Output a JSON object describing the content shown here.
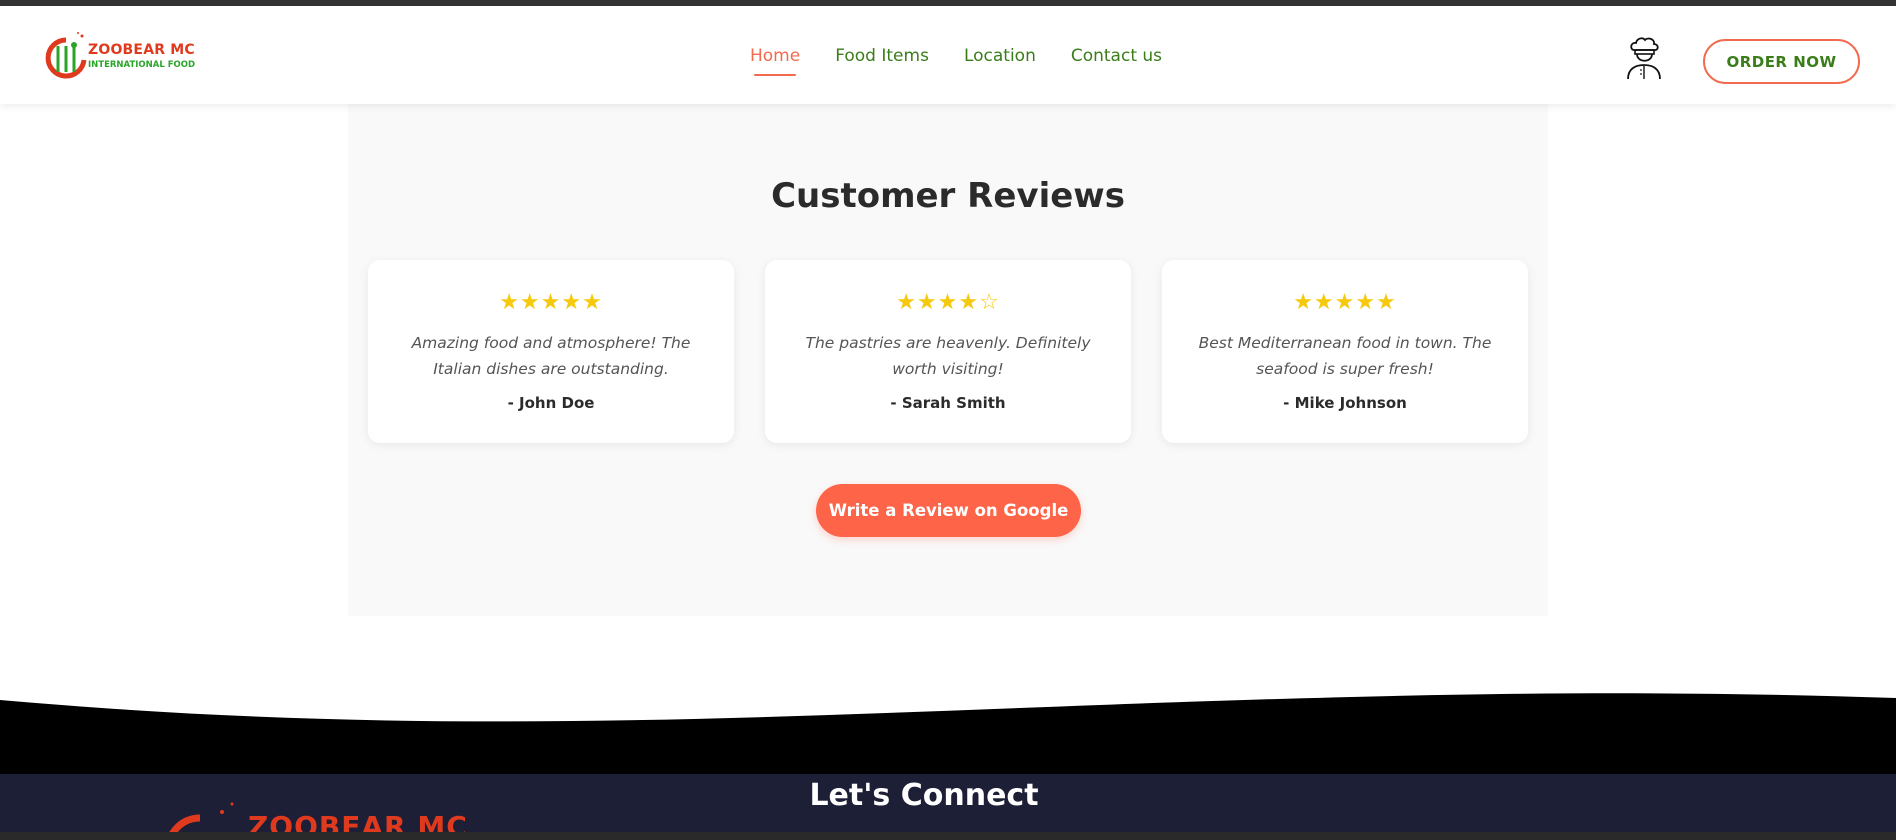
{
  "brand": {
    "name": "ZOOBEAR MC",
    "tagline": "INTERNATIONAL FOOD",
    "primary_color": "#f26b4e",
    "secondary_color": "#3a7d1a"
  },
  "nav": {
    "items": [
      {
        "label": "Home",
        "active": true
      },
      {
        "label": "Food Items",
        "active": false
      },
      {
        "label": "Location",
        "active": false
      },
      {
        "label": "Contact us",
        "active": false
      }
    ],
    "user_icon": "chef-icon",
    "order_label": "ORDER NOW"
  },
  "reviews": {
    "title": "Customer Reviews",
    "items": [
      {
        "stars": "★★★★★",
        "rating": 5,
        "text": "Amazing food and atmosphere! The Italian dishes are outstanding.",
        "author": "- John Doe"
      },
      {
        "stars": "★★★★☆",
        "rating": 4,
        "text": "The pastries are heavenly. Definitely worth visiting!",
        "author": "- Sarah Smith"
      },
      {
        "stars": "★★★★★",
        "rating": 5,
        "text": "Best Mediterranean food in town. The seafood is super fresh!",
        "author": "- Mike Johnson"
      }
    ],
    "cta_label": "Write a Review on Google"
  },
  "footer": {
    "heading": "Let's Connect",
    "logo_text": "ZOOBEAR MC"
  }
}
